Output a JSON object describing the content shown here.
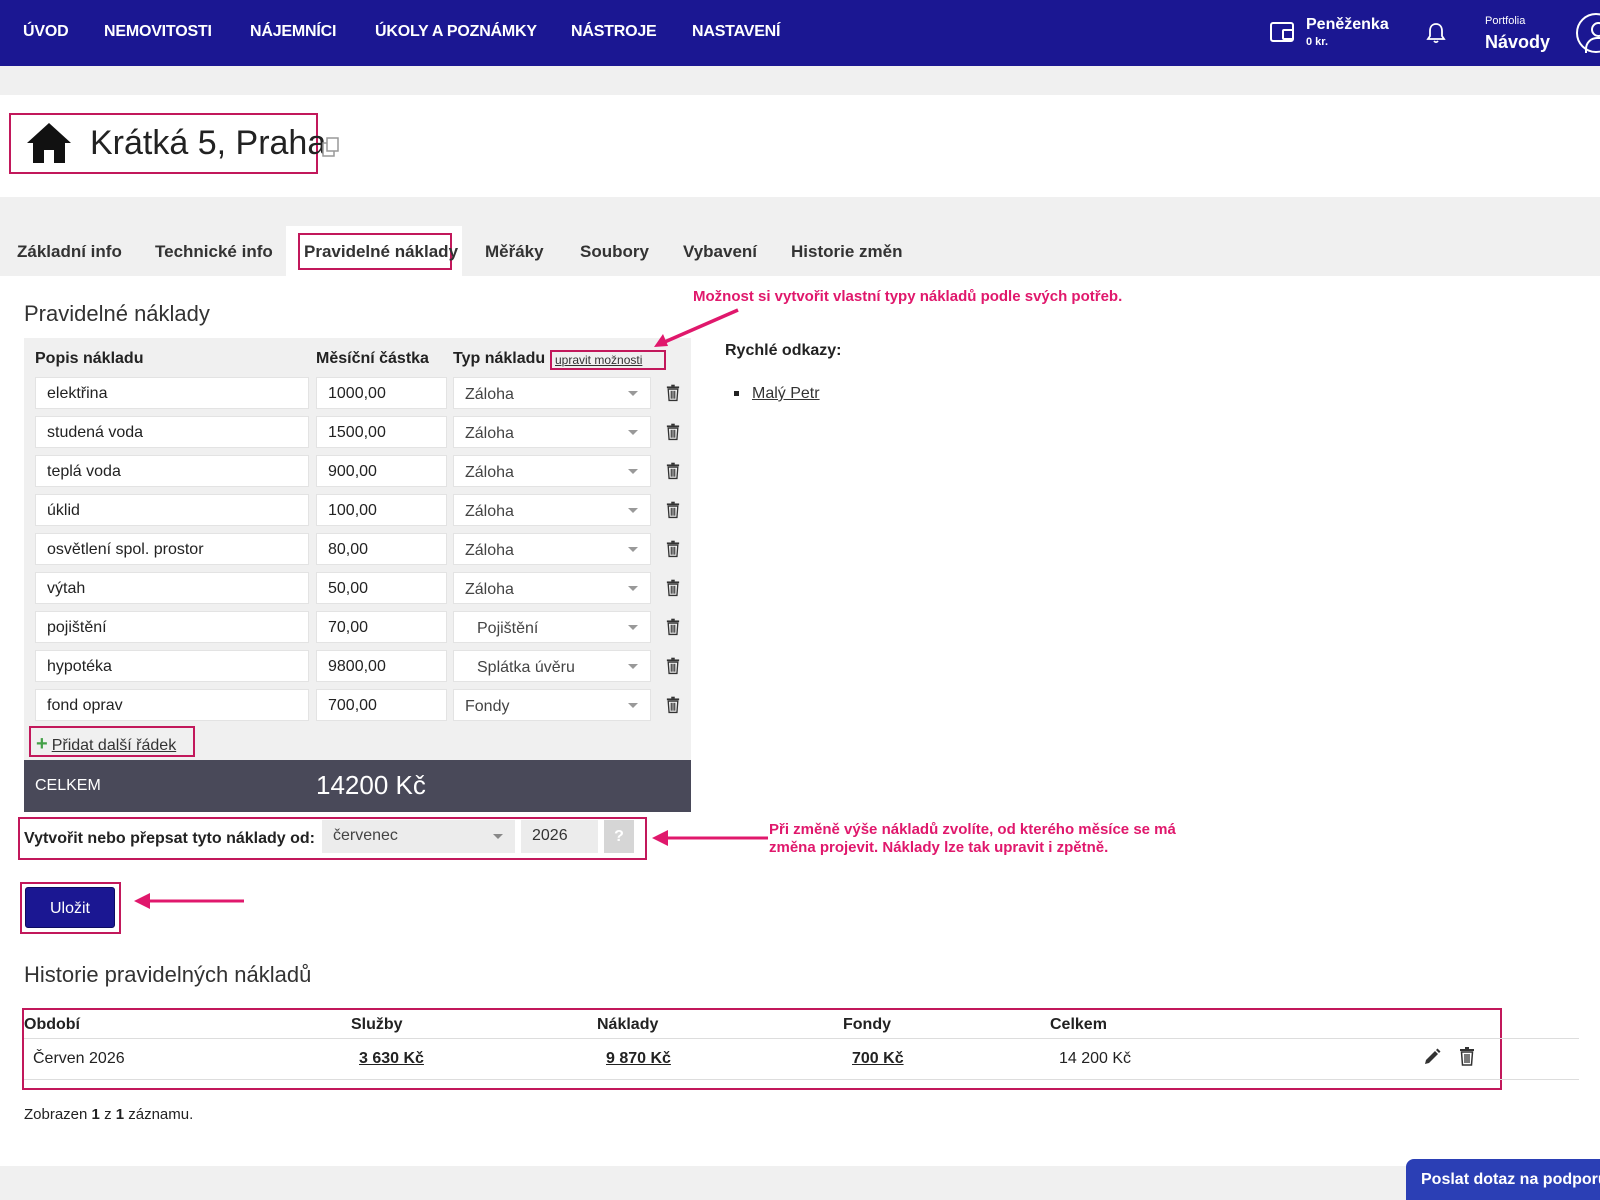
{
  "nav": {
    "items": [
      "ÚVOD",
      "NEMOVITOSTI",
      "NÁJEMNÍCI",
      "ÚKOLY A POZNÁMKY",
      "NÁSTROJE",
      "NASTAVENÍ"
    ],
    "wallet_label": "Peněženka",
    "wallet_amount": "0 kr.",
    "portfolio_label": "Portfolia",
    "portfolio_value": "Návody",
    "icons": [
      "wallet-icon",
      "bell-icon",
      "user-icon"
    ]
  },
  "property": {
    "title": "Krátká 5, Praha",
    "icons": [
      "house-icon",
      "copy-icon"
    ]
  },
  "tabs": [
    "Základní info",
    "Technické info",
    "Pravidelné náklady",
    "Měřáky",
    "Soubory",
    "Vybavení",
    "Historie změn"
  ],
  "active_tab": "Pravidelné náklady",
  "costs": {
    "section_title": "Pravidelné náklady",
    "headers": {
      "description": "Popis nákladu",
      "amount": "Měsíční částka",
      "type": "Typ nákladu"
    },
    "edit_options_link": "upravit možnosti",
    "rows": [
      {
        "description": "elektřina",
        "amount": "1000,00",
        "type": "Záloha"
      },
      {
        "description": "studená voda",
        "amount": "1500,00",
        "type": "Záloha"
      },
      {
        "description": "teplá voda",
        "amount": "900,00",
        "type": "Záloha"
      },
      {
        "description": "úklid",
        "amount": "100,00",
        "type": "Záloha"
      },
      {
        "description": "osvětlení spol. prostor",
        "amount": "80,00",
        "type": "Záloha"
      },
      {
        "description": "výtah",
        "amount": "50,00",
        "type": "Záloha"
      },
      {
        "description": "pojištění",
        "amount": "70,00",
        "type": "Pojištění"
      },
      {
        "description": "hypotéka",
        "amount": "9800,00",
        "type": "Splátka úvěru"
      },
      {
        "description": "fond oprav",
        "amount": "700,00",
        "type": "Fondy"
      }
    ],
    "add_row_label": "Přidat další řádek",
    "total_label": "CELKEM",
    "total_value": "14200 Kč",
    "from_label": "Vytvořit nebo přepsat tyto náklady od:",
    "from_month": "červenec",
    "from_year": "2026",
    "help_label": "?",
    "save_label": "Uložit"
  },
  "annotations": {
    "custom_types": "Možnost si vytvořit vlastní typy nákladů podle svých potřeb.",
    "from_month_line1": "Při změně výše nákladů zvolíte, od kterého měsíce se má",
    "from_month_line2": "změna projevit. Náklady lze tak upravit i zpětně.",
    "color": "#e0186c"
  },
  "quick_links": {
    "title": "Rychlé odkazy:",
    "items": [
      "Malý Petr"
    ]
  },
  "history": {
    "section_title": "Historie pravidelných nákladů",
    "headers": [
      "Období",
      "Služby",
      "Náklady",
      "Fondy",
      "Celkem"
    ],
    "rows": [
      {
        "period": "Červen 2026",
        "services": "3 630 Kč",
        "costs": "9 870 Kč",
        "funds": "700 Kč",
        "total": "14 200 Kč"
      }
    ],
    "records_prefix": "Zobrazen",
    "records_shown": "1",
    "records_of": "z",
    "records_total": "1",
    "records_suffix": "záznamu."
  },
  "support_label": "Poslat dotaz na podporu",
  "colors": {
    "nav": "#1b1792",
    "highlight": "#c2185b",
    "total_bar": "#494959",
    "support": "#2b3fb5"
  }
}
